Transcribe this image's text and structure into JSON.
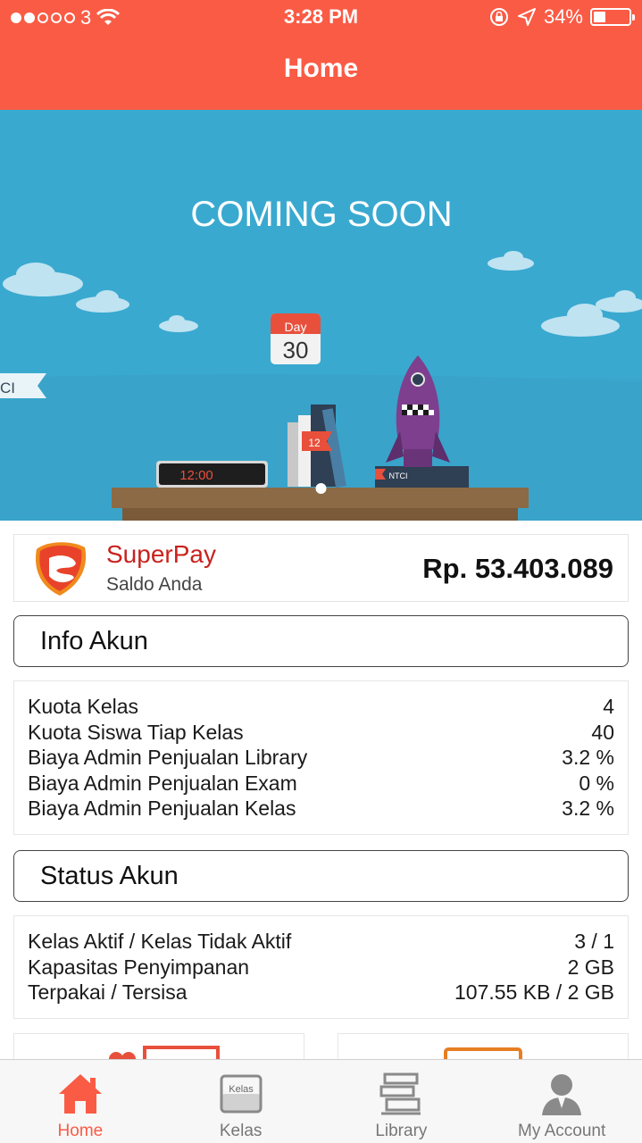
{
  "status_bar": {
    "carrier": "3",
    "time": "3:28 PM",
    "battery": "34%",
    "battery_level": 0.34
  },
  "header": {
    "title": "Home"
  },
  "banner": {
    "headline": "COMING SOON",
    "calendar_label": "Day",
    "calendar_day": "30",
    "clock": "12:00",
    "book_tag": "12",
    "flag_text": "CI",
    "box_label": "NTCI",
    "page_indicator": {
      "count": 1,
      "active": 0
    }
  },
  "superpay": {
    "name": "SuperPay",
    "subtitle": "Saldo Anda",
    "balance": "Rp. 53.403.089"
  },
  "info_akun": {
    "title": "Info Akun",
    "rows": [
      {
        "label": "Kuota Kelas",
        "value": "4"
      },
      {
        "label": "Kuota Siswa Tiap Kelas",
        "value": "40"
      },
      {
        "label": "Biaya Admin Penjualan Library",
        "value": "3.2 %"
      },
      {
        "label": "Biaya Admin Penjualan Exam",
        "value": "0 %"
      },
      {
        "label": "Biaya Admin Penjualan Kelas",
        "value": "3.2 %"
      }
    ]
  },
  "status_akun": {
    "title": "Status Akun",
    "rows": [
      {
        "label": "Kelas Aktif / Kelas Tidak Aktif",
        "value": "3 / 1"
      },
      {
        "label": "Kapasitas Penyimpanan",
        "value": "2 GB"
      },
      {
        "label": "Terpakai / Tersisa",
        "value": "107.55 KB / 2 GB"
      }
    ]
  },
  "tabbar": {
    "tabs": [
      {
        "label": "Home",
        "icon": "home-icon",
        "active": true
      },
      {
        "label": "Kelas",
        "icon": "kelas-icon",
        "icon_text": "Kelas",
        "active": false
      },
      {
        "label": "Library",
        "icon": "library-icon",
        "active": false
      },
      {
        "label": "My Account",
        "icon": "account-icon",
        "active": false
      }
    ]
  },
  "colors": {
    "brand": "#fa5b45",
    "banner_sky": "#3aa9d0",
    "superpay_red": "#c8221e"
  }
}
